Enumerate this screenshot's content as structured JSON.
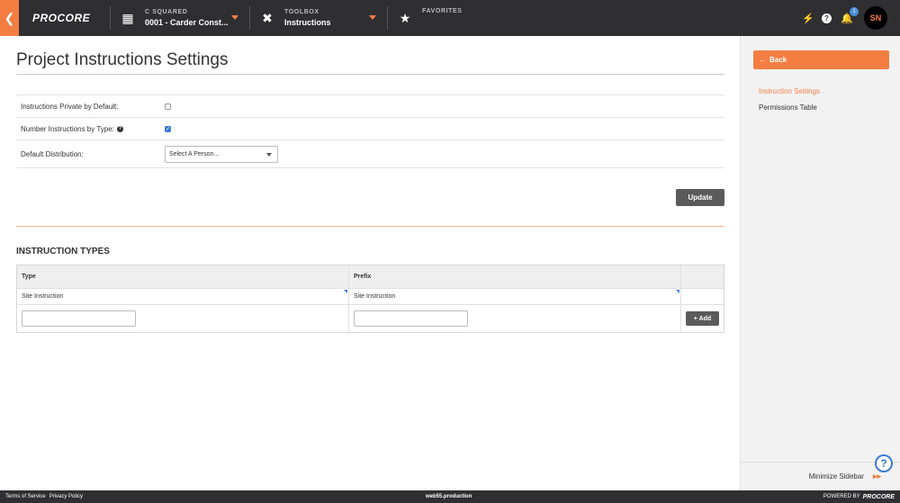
{
  "topbar": {
    "logo": "PROCORE",
    "company": {
      "eyebrow": "C SQUARED",
      "value": "0001 - Carder Const..."
    },
    "tool": {
      "eyebrow": "TOOLBOX",
      "value": "Instructions"
    },
    "favorites": {
      "eyebrow": "FAVORITES"
    },
    "notification_count": "1",
    "avatar_initials": "SN",
    "icons": [
      "chevron-left-icon",
      "building-icon",
      "tools-icon",
      "star-icon",
      "plug-icon",
      "help-icon",
      "bell-icon"
    ]
  },
  "page": {
    "title": "Project Instructions Settings",
    "settings": [
      {
        "label": "Instructions Private by Default:",
        "checked": false
      },
      {
        "label": "Number Instructions by Type:",
        "checked": true
      },
      {
        "label": "Default Distribution:",
        "placeholder": "Select A Person..."
      }
    ],
    "update_label": "Update"
  },
  "instruction_types": {
    "title": "INSTRUCTION TYPES",
    "columns": [
      "Type",
      "Prefix",
      ""
    ],
    "rows": [
      {
        "type": "Site Instruction",
        "prefix": "Site Instruction"
      }
    ],
    "add_label": "+ Add"
  },
  "sidebar": {
    "back_label": "Back",
    "links": [
      {
        "label": "Instruction Settings",
        "active": true
      },
      {
        "label": "Permissions Table",
        "active": false
      }
    ],
    "minimize_label": "Minimize Sidebar"
  },
  "footer": {
    "terms": "Terms of Service",
    "privacy": "Privacy Policy",
    "server": "web55.production",
    "powered_by": "POWERED BY",
    "brand": "PROCORE"
  },
  "colors": {
    "accent": "#f47e42",
    "nav_bg": "#2f2f31",
    "link_blue": "#3a7bd5"
  }
}
